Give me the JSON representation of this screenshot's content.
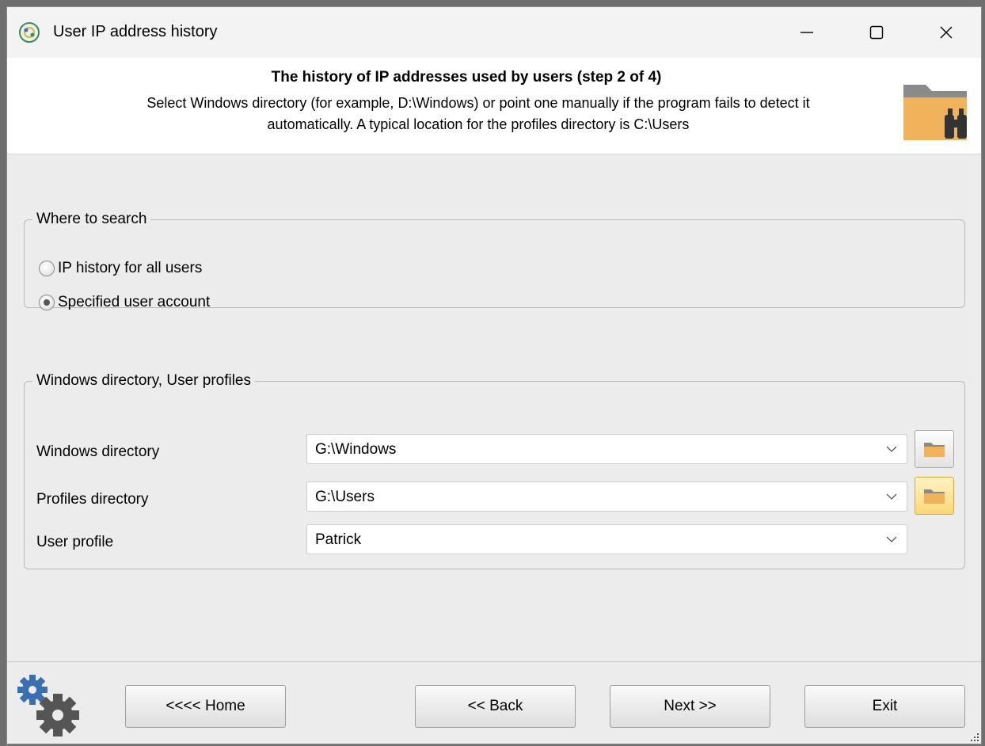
{
  "window": {
    "title": "User IP address history"
  },
  "header": {
    "title": "The history of IP addresses used by users (step 2 of 4)",
    "description_line1": "Select Windows directory (for example, D:\\Windows) or point one manually if the program fails to detect it",
    "description_line2": "automatically. A typical location for the profiles directory is C:\\Users"
  },
  "where_to_search": {
    "legend": "Where to search",
    "options": [
      {
        "label": "IP history for all users",
        "checked": false
      },
      {
        "label": "Specified user account",
        "checked": true
      }
    ]
  },
  "directories": {
    "legend": "Windows directory, User profiles",
    "windows_dir": {
      "label": "Windows directory",
      "value": "G:\\Windows"
    },
    "profiles_dir": {
      "label": "Profiles directory",
      "value": "G:\\Users"
    },
    "user_profile": {
      "label": "User profile",
      "value": "Patrick"
    }
  },
  "footer": {
    "home_label": "<<<< Home",
    "back_label": "<< Back",
    "next_label": "Next >>",
    "exit_label": "Exit"
  },
  "colors": {
    "folder": "#f0b35c",
    "gear": "#3a6fb0"
  }
}
